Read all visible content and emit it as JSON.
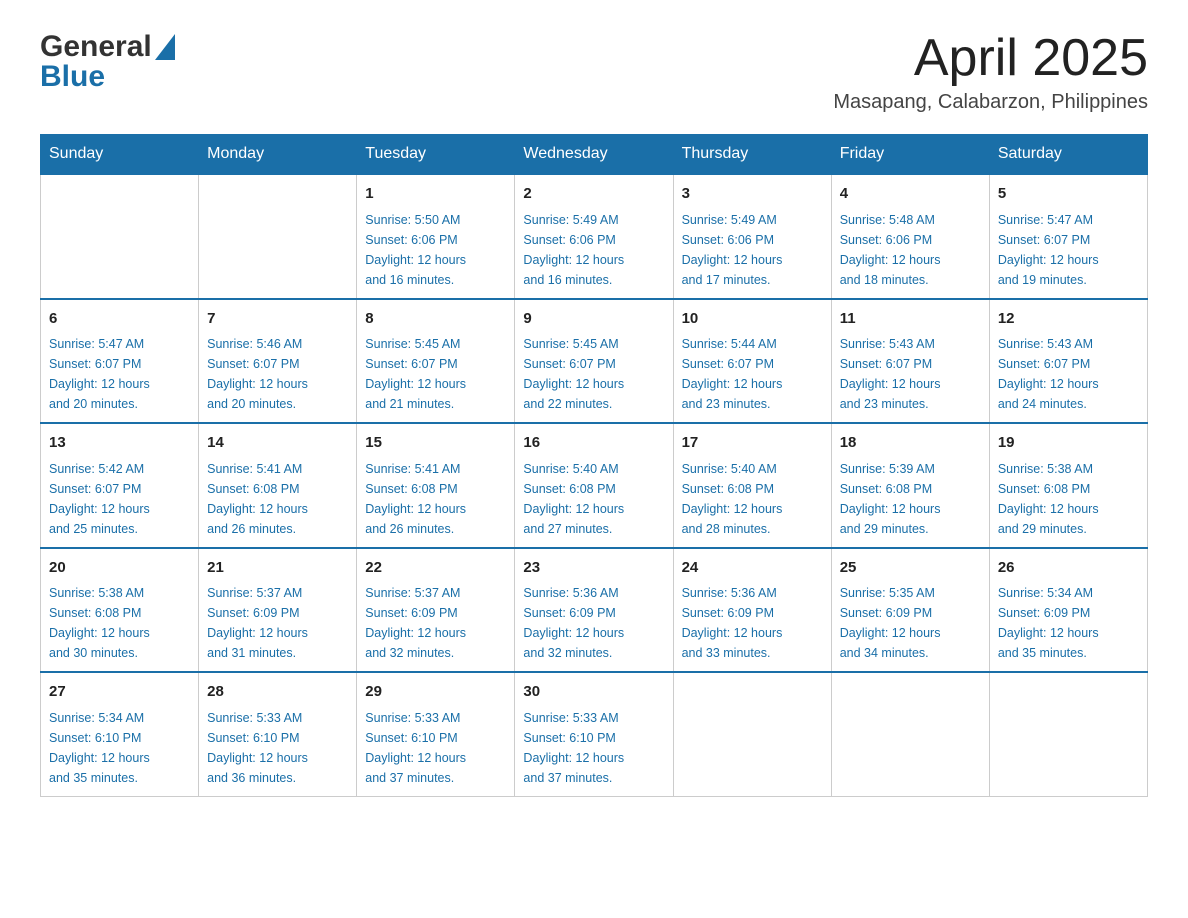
{
  "header": {
    "title": "April 2025",
    "subtitle": "Masapang, Calabarzon, Philippines"
  },
  "weekdays": [
    "Sunday",
    "Monday",
    "Tuesday",
    "Wednesday",
    "Thursday",
    "Friday",
    "Saturday"
  ],
  "weeks": [
    [
      {
        "day": "",
        "info": ""
      },
      {
        "day": "",
        "info": ""
      },
      {
        "day": "1",
        "info": "Sunrise: 5:50 AM\nSunset: 6:06 PM\nDaylight: 12 hours\nand 16 minutes."
      },
      {
        "day": "2",
        "info": "Sunrise: 5:49 AM\nSunset: 6:06 PM\nDaylight: 12 hours\nand 16 minutes."
      },
      {
        "day": "3",
        "info": "Sunrise: 5:49 AM\nSunset: 6:06 PM\nDaylight: 12 hours\nand 17 minutes."
      },
      {
        "day": "4",
        "info": "Sunrise: 5:48 AM\nSunset: 6:06 PM\nDaylight: 12 hours\nand 18 minutes."
      },
      {
        "day": "5",
        "info": "Sunrise: 5:47 AM\nSunset: 6:07 PM\nDaylight: 12 hours\nand 19 minutes."
      }
    ],
    [
      {
        "day": "6",
        "info": "Sunrise: 5:47 AM\nSunset: 6:07 PM\nDaylight: 12 hours\nand 20 minutes."
      },
      {
        "day": "7",
        "info": "Sunrise: 5:46 AM\nSunset: 6:07 PM\nDaylight: 12 hours\nand 20 minutes."
      },
      {
        "day": "8",
        "info": "Sunrise: 5:45 AM\nSunset: 6:07 PM\nDaylight: 12 hours\nand 21 minutes."
      },
      {
        "day": "9",
        "info": "Sunrise: 5:45 AM\nSunset: 6:07 PM\nDaylight: 12 hours\nand 22 minutes."
      },
      {
        "day": "10",
        "info": "Sunrise: 5:44 AM\nSunset: 6:07 PM\nDaylight: 12 hours\nand 23 minutes."
      },
      {
        "day": "11",
        "info": "Sunrise: 5:43 AM\nSunset: 6:07 PM\nDaylight: 12 hours\nand 23 minutes."
      },
      {
        "day": "12",
        "info": "Sunrise: 5:43 AM\nSunset: 6:07 PM\nDaylight: 12 hours\nand 24 minutes."
      }
    ],
    [
      {
        "day": "13",
        "info": "Sunrise: 5:42 AM\nSunset: 6:07 PM\nDaylight: 12 hours\nand 25 minutes."
      },
      {
        "day": "14",
        "info": "Sunrise: 5:41 AM\nSunset: 6:08 PM\nDaylight: 12 hours\nand 26 minutes."
      },
      {
        "day": "15",
        "info": "Sunrise: 5:41 AM\nSunset: 6:08 PM\nDaylight: 12 hours\nand 26 minutes."
      },
      {
        "day": "16",
        "info": "Sunrise: 5:40 AM\nSunset: 6:08 PM\nDaylight: 12 hours\nand 27 minutes."
      },
      {
        "day": "17",
        "info": "Sunrise: 5:40 AM\nSunset: 6:08 PM\nDaylight: 12 hours\nand 28 minutes."
      },
      {
        "day": "18",
        "info": "Sunrise: 5:39 AM\nSunset: 6:08 PM\nDaylight: 12 hours\nand 29 minutes."
      },
      {
        "day": "19",
        "info": "Sunrise: 5:38 AM\nSunset: 6:08 PM\nDaylight: 12 hours\nand 29 minutes."
      }
    ],
    [
      {
        "day": "20",
        "info": "Sunrise: 5:38 AM\nSunset: 6:08 PM\nDaylight: 12 hours\nand 30 minutes."
      },
      {
        "day": "21",
        "info": "Sunrise: 5:37 AM\nSunset: 6:09 PM\nDaylight: 12 hours\nand 31 minutes."
      },
      {
        "day": "22",
        "info": "Sunrise: 5:37 AM\nSunset: 6:09 PM\nDaylight: 12 hours\nand 32 minutes."
      },
      {
        "day": "23",
        "info": "Sunrise: 5:36 AM\nSunset: 6:09 PM\nDaylight: 12 hours\nand 32 minutes."
      },
      {
        "day": "24",
        "info": "Sunrise: 5:36 AM\nSunset: 6:09 PM\nDaylight: 12 hours\nand 33 minutes."
      },
      {
        "day": "25",
        "info": "Sunrise: 5:35 AM\nSunset: 6:09 PM\nDaylight: 12 hours\nand 34 minutes."
      },
      {
        "day": "26",
        "info": "Sunrise: 5:34 AM\nSunset: 6:09 PM\nDaylight: 12 hours\nand 35 minutes."
      }
    ],
    [
      {
        "day": "27",
        "info": "Sunrise: 5:34 AM\nSunset: 6:10 PM\nDaylight: 12 hours\nand 35 minutes."
      },
      {
        "day": "28",
        "info": "Sunrise: 5:33 AM\nSunset: 6:10 PM\nDaylight: 12 hours\nand 36 minutes."
      },
      {
        "day": "29",
        "info": "Sunrise: 5:33 AM\nSunset: 6:10 PM\nDaylight: 12 hours\nand 37 minutes."
      },
      {
        "day": "30",
        "info": "Sunrise: 5:33 AM\nSunset: 6:10 PM\nDaylight: 12 hours\nand 37 minutes."
      },
      {
        "day": "",
        "info": ""
      },
      {
        "day": "",
        "info": ""
      },
      {
        "day": "",
        "info": ""
      }
    ]
  ]
}
